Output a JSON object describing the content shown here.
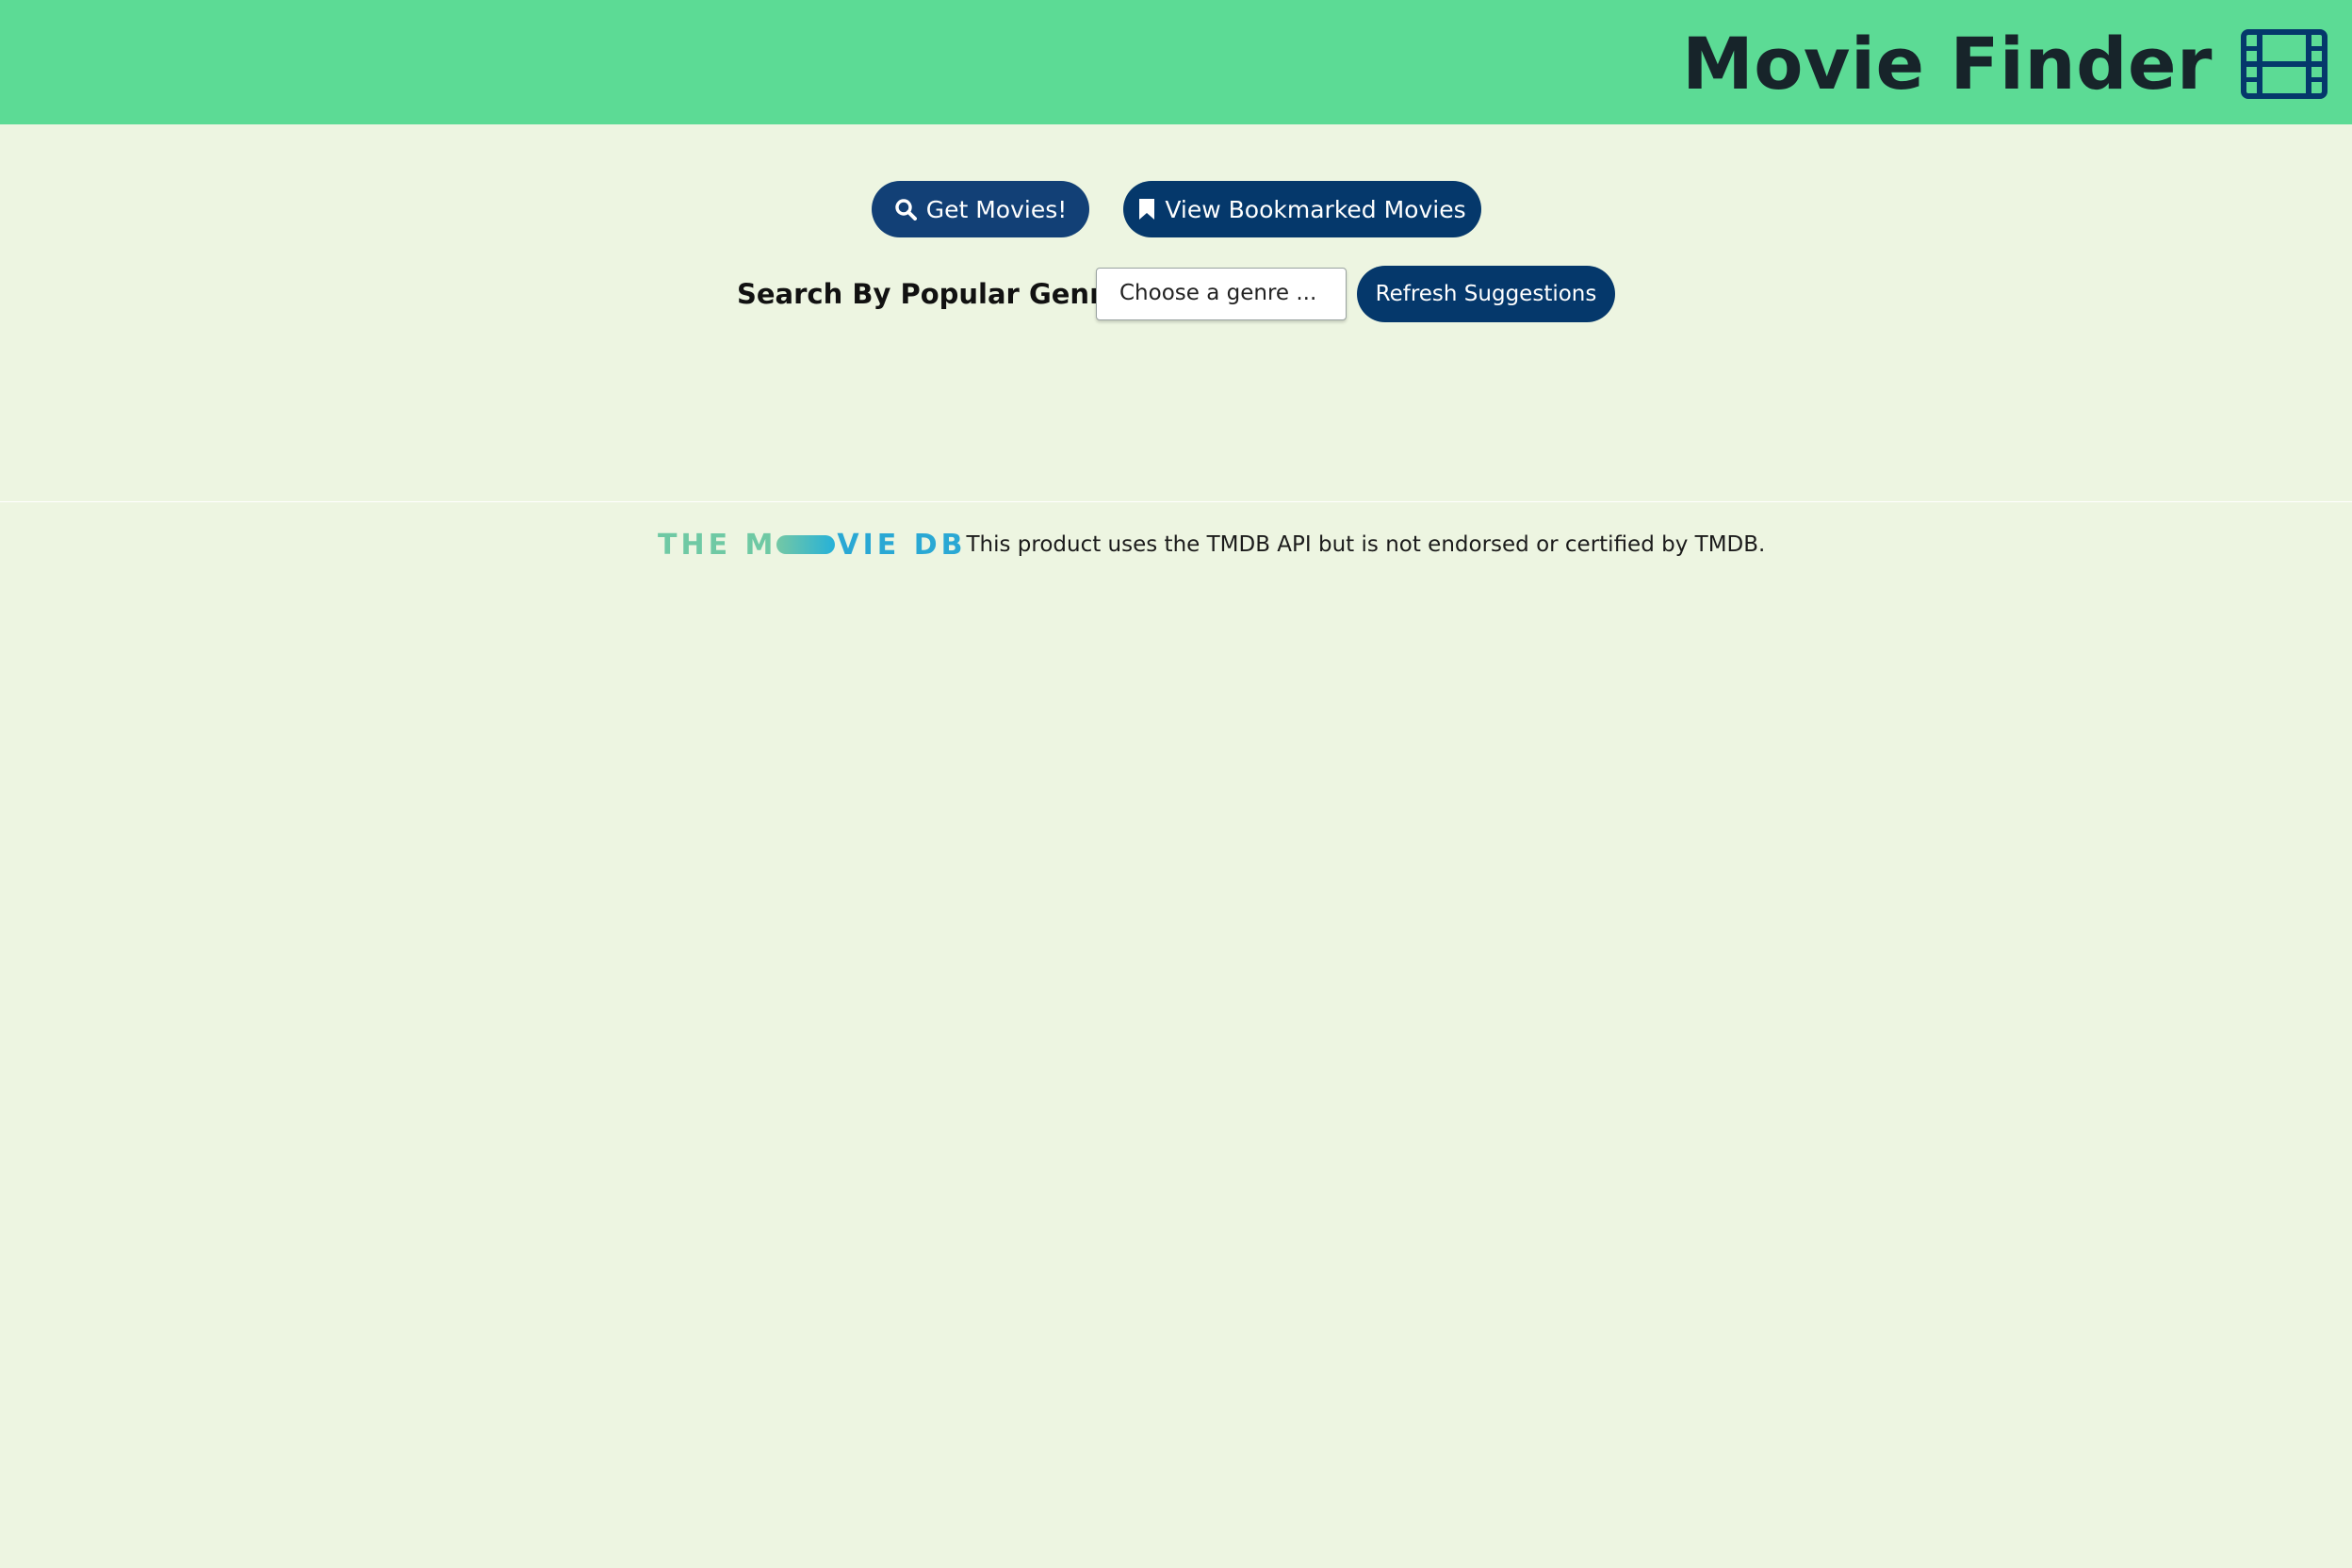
{
  "header": {
    "title": "Movie Finder",
    "icon": "film-icon",
    "background_color": "#5cdb95"
  },
  "actions": {
    "get_movies": {
      "label": "Get Movies!",
      "icon": "search-icon"
    },
    "view_bookmarks": {
      "label": "View Bookmarked Movies",
      "icon": "bookmark-icon"
    },
    "button_color": "#05386b"
  },
  "genre_search": {
    "label": "Search By Popular Genres:",
    "select_value": "Choose a genre ...",
    "refresh_label": "Refresh Suggestions"
  },
  "footer": {
    "logo_part1": "THE M",
    "logo_part2": "VIE DB",
    "attribution": "This product uses the TMDB API but is not endorsed or certified by TMDB."
  },
  "page": {
    "background_color": "#edf5e1"
  }
}
